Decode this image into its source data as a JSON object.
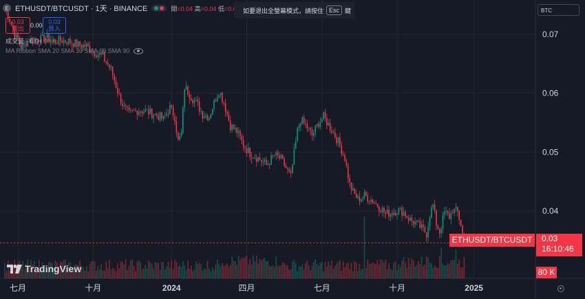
{
  "header": {
    "symbol_icon": "E",
    "title": "ETHUSDT/BTCUSDT · 1天 · BINANCE",
    "ohlc": {
      "open_label": "開",
      "open": "=0.04",
      "high_label": "高",
      "high": "=0.04",
      "low_label": "低",
      "low": "=0.0"
    }
  },
  "trade": {
    "sell_price": "0.03",
    "sell_label": "賣出",
    "spread": "0.00",
    "buy_price": "0.03",
    "buy_label": "買入"
  },
  "volume_label": {
    "text": "成交量 · ETH",
    "value": "80 K"
  },
  "ma_label": "MA Ribbon SMA 20 SMA 30 SMA 60 SMA 90",
  "toast": {
    "text": "如要退出全螢幕模式，請按住",
    "key": "Esc",
    "suffix": "鍵"
  },
  "currency": "BTC",
  "last_tag": {
    "symbol": "ETHUSDT/BTCUSDT",
    "price": "0.03",
    "countdown": "16:10:46"
  },
  "volume_tag": "80 K",
  "logo": "TradingView",
  "colors": {
    "up": "#089981",
    "down": "#f23645",
    "bg": "#161a25",
    "grid": "#232733",
    "text": "#d1d4dc"
  },
  "chart_data": {
    "type": "candlestick",
    "y_ticks": [
      "0.07",
      "0.06",
      "0.05",
      "0.04"
    ],
    "y_tick_values": [
      0.07,
      0.06,
      0.05,
      0.04
    ],
    "ylim": [
      0.026,
      0.077
    ],
    "x_ticks": [
      {
        "label": "七月",
        "i": 8
      },
      {
        "label": "十月",
        "i": 54
      },
      {
        "label": "2024",
        "i": 102
      },
      {
        "label": "四月",
        "i": 148
      },
      {
        "label": "七月",
        "i": 194
      },
      {
        "label": "十月",
        "i": 240
      },
      {
        "label": "2025",
        "i": 287
      }
    ],
    "n_bars": 282,
    "anchors": [
      [
        0,
        0.0745
      ],
      [
        3,
        0.0725
      ],
      [
        6,
        0.07
      ],
      [
        10,
        0.0678
      ],
      [
        15,
        0.0692
      ],
      [
        20,
        0.0688
      ],
      [
        25,
        0.0695
      ],
      [
        30,
        0.0688
      ],
      [
        35,
        0.069
      ],
      [
        40,
        0.0688
      ],
      [
        45,
        0.0682
      ],
      [
        50,
        0.068
      ],
      [
        55,
        0.067
      ],
      [
        60,
        0.0662
      ],
      [
        65,
        0.064
      ],
      [
        70,
        0.0595
      ],
      [
        73,
        0.0575
      ],
      [
        76,
        0.0565
      ],
      [
        82,
        0.0572
      ],
      [
        88,
        0.0568
      ],
      [
        93,
        0.0563
      ],
      [
        97,
        0.0556
      ],
      [
        101,
        0.0575
      ],
      [
        104,
        0.056
      ],
      [
        106,
        0.0518
      ],
      [
        108,
        0.053
      ],
      [
        110,
        0.061
      ],
      [
        114,
        0.0595
      ],
      [
        118,
        0.058
      ],
      [
        121,
        0.0565
      ],
      [
        125,
        0.056
      ],
      [
        129,
        0.0592
      ],
      [
        131,
        0.0605
      ],
      [
        134,
        0.0585
      ],
      [
        138,
        0.0545
      ],
      [
        142,
        0.0535
      ],
      [
        146,
        0.0512
      ],
      [
        150,
        0.0498
      ],
      [
        155,
        0.049
      ],
      [
        160,
        0.0478
      ],
      [
        165,
        0.0495
      ],
      [
        169,
        0.0488
      ],
      [
        173,
        0.0468
      ],
      [
        175,
        0.0458
      ],
      [
        177,
        0.0498
      ],
      [
        179,
        0.0535
      ],
      [
        181,
        0.0555
      ],
      [
        185,
        0.0542
      ],
      [
        188,
        0.0528
      ],
      [
        192,
        0.055
      ],
      [
        195,
        0.056
      ],
      [
        200,
        0.0538
      ],
      [
        204,
        0.0518
      ],
      [
        208,
        0.049
      ],
      [
        211,
        0.0445
      ],
      [
        213,
        0.0432
      ],
      [
        216,
        0.042
      ],
      [
        220,
        0.0426
      ],
      [
        225,
        0.0418
      ],
      [
        230,
        0.0405
      ],
      [
        233,
        0.0395
      ],
      [
        237,
        0.0398
      ],
      [
        240,
        0.0402
      ],
      [
        244,
        0.0398
      ],
      [
        248,
        0.0385
      ],
      [
        252,
        0.0378
      ],
      [
        256,
        0.0368
      ],
      [
        258,
        0.0362
      ],
      [
        260,
        0.0395
      ],
      [
        262,
        0.041
      ],
      [
        264,
        0.0378
      ],
      [
        266,
        0.0365
      ],
      [
        269,
        0.0398
      ],
      [
        272,
        0.039
      ],
      [
        274,
        0.0402
      ],
      [
        277,
        0.0398
      ],
      [
        279,
        0.0378
      ],
      [
        281,
        0.0345
      ]
    ],
    "volume_spikes": [
      [
        220,
        0.9
      ],
      [
        276,
        0.42
      ],
      [
        267,
        0.45
      ],
      [
        258,
        0.32
      ],
      [
        133,
        0.22
      ],
      [
        230,
        0.28
      ]
    ]
  }
}
